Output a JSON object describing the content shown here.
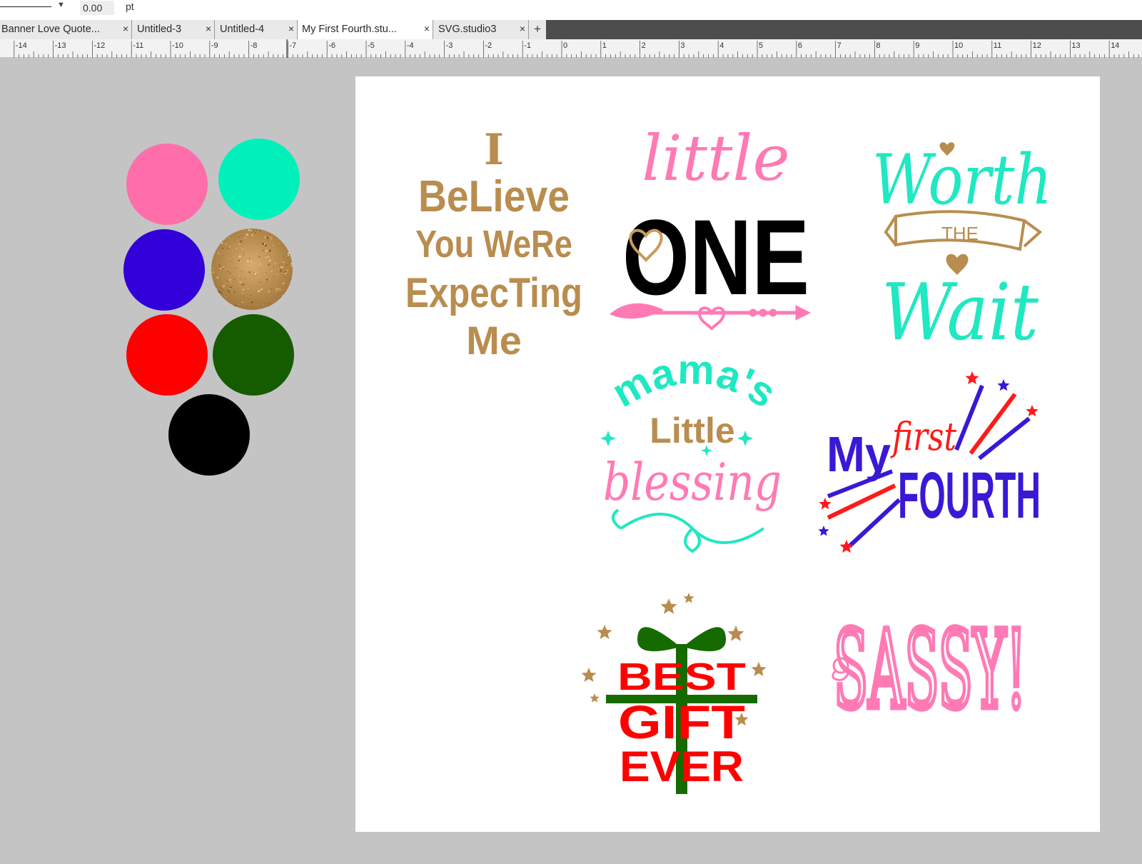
{
  "toolbar": {
    "line_width_value": "0.00",
    "unit_label": "pt",
    "dropdown_arrow": "▼"
  },
  "tabs": [
    {
      "label": "Banner Love Quote...",
      "close": "×",
      "active": false
    },
    {
      "label": "Untitled-3",
      "close": "×",
      "active": false
    },
    {
      "label": "Untitled-4",
      "close": "×",
      "active": false
    },
    {
      "label": "My First Fourth.stu...",
      "close": "×",
      "active": true
    },
    {
      "label": "SVG.studio3",
      "close": "×",
      "active": false
    }
  ],
  "tab_add_label": "+",
  "ruler": {
    "labels": [
      "-14",
      "-13",
      "-12",
      "-11",
      "-10",
      "-9",
      "-8",
      "-7",
      "-6",
      "-5",
      "-4",
      "-3",
      "-2",
      "-1",
      "0",
      "1",
      "2",
      "3",
      "4",
      "5",
      "6",
      "7",
      "8",
      "9",
      "10",
      "11",
      "12",
      "13",
      "14"
    ]
  },
  "swatches": [
    {
      "name": "pink",
      "color": "#ff6eaa"
    },
    {
      "name": "mint",
      "color": "#00f0bc"
    },
    {
      "name": "blue",
      "color": "#3200d8"
    },
    {
      "name": "gold-glitter",
      "color": "#b98d4f"
    },
    {
      "name": "red",
      "color": "#ff0000"
    },
    {
      "name": "dark-green",
      "color": "#155c00"
    },
    {
      "name": "black",
      "color": "#000000"
    }
  ],
  "designs": {
    "believe": {
      "lines": [
        "I",
        "BeLieve",
        "You WeRe",
        "ExpecTing",
        "Me"
      ],
      "color": "#b98d4f"
    },
    "little_one": {
      "script": "little",
      "block": "ONE",
      "script_color": "#ff7ab4",
      "block_color": "#000000",
      "accent": "#c99a5c"
    },
    "worth_wait": {
      "top": "Worth",
      "banner": "THE",
      "bottom": "Wait",
      "color": "#1fe8c2",
      "accent": "#b98d4f"
    },
    "mamas_blessing": {
      "arc": "mama's",
      "middle": "Little",
      "script": "blessing",
      "arc_color": "#1fe8c2",
      "middle_color": "#b98d4f",
      "script_color": "#ff7ab4"
    },
    "first_fourth": {
      "my": "My",
      "first": "first",
      "fourth": "FOURTH",
      "blue": "#3a18d6",
      "red": "#ff1a1a"
    },
    "best_gift": {
      "lines": [
        "BEST",
        "GIFT",
        "EVER"
      ],
      "text_color": "#ff0000",
      "ribbon_color": "#166b00",
      "star_color": "#b98d4f"
    },
    "sassy": {
      "text": "SASSY!",
      "color": "#ff7ab4"
    }
  }
}
